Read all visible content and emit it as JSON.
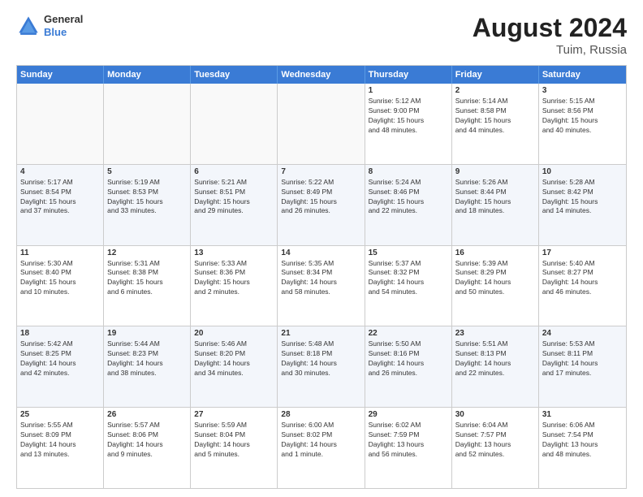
{
  "logo": {
    "line1": "General",
    "line2": "Blue"
  },
  "title": "August 2024",
  "subtitle": "Tuim, Russia",
  "days": [
    "Sunday",
    "Monday",
    "Tuesday",
    "Wednesday",
    "Thursday",
    "Friday",
    "Saturday"
  ],
  "weeks": [
    [
      {
        "day": "",
        "content": "",
        "empty": true
      },
      {
        "day": "",
        "content": "",
        "empty": true
      },
      {
        "day": "",
        "content": "",
        "empty": true
      },
      {
        "day": "",
        "content": "",
        "empty": true
      },
      {
        "day": "1",
        "content": "Sunrise: 5:12 AM\nSunset: 9:00 PM\nDaylight: 15 hours\nand 48 minutes.",
        "empty": false
      },
      {
        "day": "2",
        "content": "Sunrise: 5:14 AM\nSunset: 8:58 PM\nDaylight: 15 hours\nand 44 minutes.",
        "empty": false
      },
      {
        "day": "3",
        "content": "Sunrise: 5:15 AM\nSunset: 8:56 PM\nDaylight: 15 hours\nand 40 minutes.",
        "empty": false
      }
    ],
    [
      {
        "day": "4",
        "content": "Sunrise: 5:17 AM\nSunset: 8:54 PM\nDaylight: 15 hours\nand 37 minutes.",
        "empty": false
      },
      {
        "day": "5",
        "content": "Sunrise: 5:19 AM\nSunset: 8:53 PM\nDaylight: 15 hours\nand 33 minutes.",
        "empty": false
      },
      {
        "day": "6",
        "content": "Sunrise: 5:21 AM\nSunset: 8:51 PM\nDaylight: 15 hours\nand 29 minutes.",
        "empty": false
      },
      {
        "day": "7",
        "content": "Sunrise: 5:22 AM\nSunset: 8:49 PM\nDaylight: 15 hours\nand 26 minutes.",
        "empty": false
      },
      {
        "day": "8",
        "content": "Sunrise: 5:24 AM\nSunset: 8:46 PM\nDaylight: 15 hours\nand 22 minutes.",
        "empty": false
      },
      {
        "day": "9",
        "content": "Sunrise: 5:26 AM\nSunset: 8:44 PM\nDaylight: 15 hours\nand 18 minutes.",
        "empty": false
      },
      {
        "day": "10",
        "content": "Sunrise: 5:28 AM\nSunset: 8:42 PM\nDaylight: 15 hours\nand 14 minutes.",
        "empty": false
      }
    ],
    [
      {
        "day": "11",
        "content": "Sunrise: 5:30 AM\nSunset: 8:40 PM\nDaylight: 15 hours\nand 10 minutes.",
        "empty": false
      },
      {
        "day": "12",
        "content": "Sunrise: 5:31 AM\nSunset: 8:38 PM\nDaylight: 15 hours\nand 6 minutes.",
        "empty": false
      },
      {
        "day": "13",
        "content": "Sunrise: 5:33 AM\nSunset: 8:36 PM\nDaylight: 15 hours\nand 2 minutes.",
        "empty": false
      },
      {
        "day": "14",
        "content": "Sunrise: 5:35 AM\nSunset: 8:34 PM\nDaylight: 14 hours\nand 58 minutes.",
        "empty": false
      },
      {
        "day": "15",
        "content": "Sunrise: 5:37 AM\nSunset: 8:32 PM\nDaylight: 14 hours\nand 54 minutes.",
        "empty": false
      },
      {
        "day": "16",
        "content": "Sunrise: 5:39 AM\nSunset: 8:29 PM\nDaylight: 14 hours\nand 50 minutes.",
        "empty": false
      },
      {
        "day": "17",
        "content": "Sunrise: 5:40 AM\nSunset: 8:27 PM\nDaylight: 14 hours\nand 46 minutes.",
        "empty": false
      }
    ],
    [
      {
        "day": "18",
        "content": "Sunrise: 5:42 AM\nSunset: 8:25 PM\nDaylight: 14 hours\nand 42 minutes.",
        "empty": false
      },
      {
        "day": "19",
        "content": "Sunrise: 5:44 AM\nSunset: 8:23 PM\nDaylight: 14 hours\nand 38 minutes.",
        "empty": false
      },
      {
        "day": "20",
        "content": "Sunrise: 5:46 AM\nSunset: 8:20 PM\nDaylight: 14 hours\nand 34 minutes.",
        "empty": false
      },
      {
        "day": "21",
        "content": "Sunrise: 5:48 AM\nSunset: 8:18 PM\nDaylight: 14 hours\nand 30 minutes.",
        "empty": false
      },
      {
        "day": "22",
        "content": "Sunrise: 5:50 AM\nSunset: 8:16 PM\nDaylight: 14 hours\nand 26 minutes.",
        "empty": false
      },
      {
        "day": "23",
        "content": "Sunrise: 5:51 AM\nSunset: 8:13 PM\nDaylight: 14 hours\nand 22 minutes.",
        "empty": false
      },
      {
        "day": "24",
        "content": "Sunrise: 5:53 AM\nSunset: 8:11 PM\nDaylight: 14 hours\nand 17 minutes.",
        "empty": false
      }
    ],
    [
      {
        "day": "25",
        "content": "Sunrise: 5:55 AM\nSunset: 8:09 PM\nDaylight: 14 hours\nand 13 minutes.",
        "empty": false
      },
      {
        "day": "26",
        "content": "Sunrise: 5:57 AM\nSunset: 8:06 PM\nDaylight: 14 hours\nand 9 minutes.",
        "empty": false
      },
      {
        "day": "27",
        "content": "Sunrise: 5:59 AM\nSunset: 8:04 PM\nDaylight: 14 hours\nand 5 minutes.",
        "empty": false
      },
      {
        "day": "28",
        "content": "Sunrise: 6:00 AM\nSunset: 8:02 PM\nDaylight: 14 hours\nand 1 minute.",
        "empty": false
      },
      {
        "day": "29",
        "content": "Sunrise: 6:02 AM\nSunset: 7:59 PM\nDaylight: 13 hours\nand 56 minutes.",
        "empty": false
      },
      {
        "day": "30",
        "content": "Sunrise: 6:04 AM\nSunset: 7:57 PM\nDaylight: 13 hours\nand 52 minutes.",
        "empty": false
      },
      {
        "day": "31",
        "content": "Sunrise: 6:06 AM\nSunset: 7:54 PM\nDaylight: 13 hours\nand 48 minutes.",
        "empty": false
      }
    ]
  ]
}
